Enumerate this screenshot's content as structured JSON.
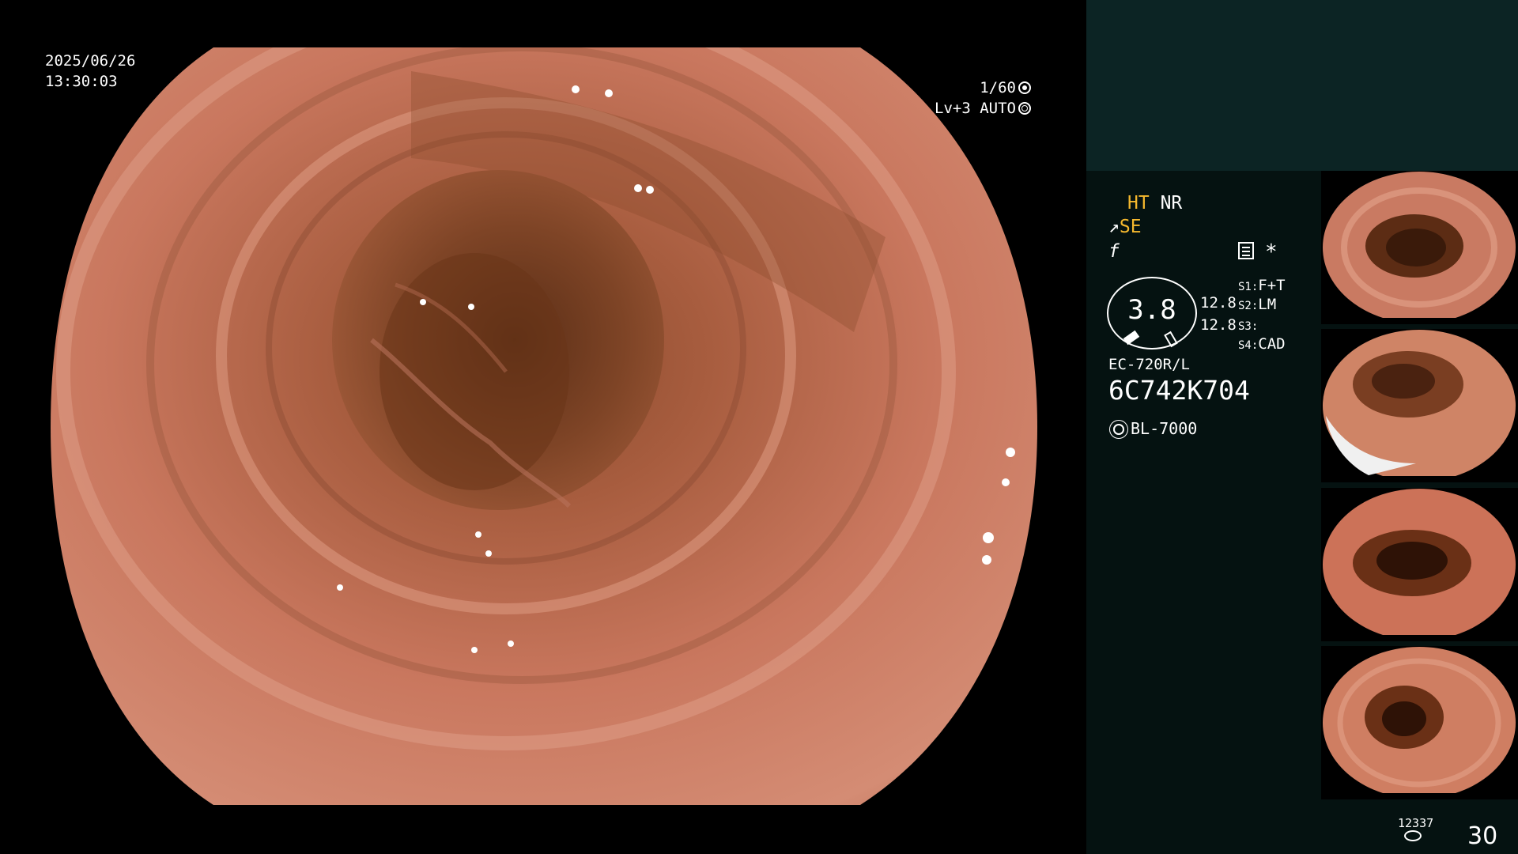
{
  "overlay": {
    "date": "2025/06/26",
    "time": "13:30:03",
    "shutter": "1/60",
    "iris": "Lv+3 AUTO"
  },
  "panel": {
    "ht": "HT",
    "nr": "NR",
    "se": "SE",
    "se_icon": "scope-angle-icon",
    "f_glyph": "f",
    "memo_icon": "memo-icon",
    "asterisk": "*",
    "gauge_value": "3.8",
    "value_1": "12.8",
    "value_2": "12.8",
    "switches": [
      {
        "key": "S1",
        "value": "F+T"
      },
      {
        "key": "S2",
        "value": "LM"
      },
      {
        "key": "S3",
        "value": ""
      },
      {
        "key": "S4",
        "value": "CAD"
      }
    ],
    "scope_model": "EC-720R/L",
    "scope_serial": "6C742K704",
    "light_source": "BL-7000",
    "light_icon": "sun-icon",
    "capture_count": "12337",
    "capture_icon": "storage-disk-icon",
    "frame_number": "30"
  },
  "colors": {
    "panel_bg": "#051211",
    "panel_top_bg": "#0c2424",
    "accent_yellow": "#f5b82e",
    "tissue": "#c9775e"
  },
  "thumbnails": [
    {
      "label": "thumbnail-1"
    },
    {
      "label": "thumbnail-2"
    },
    {
      "label": "thumbnail-3"
    },
    {
      "label": "thumbnail-4"
    }
  ]
}
